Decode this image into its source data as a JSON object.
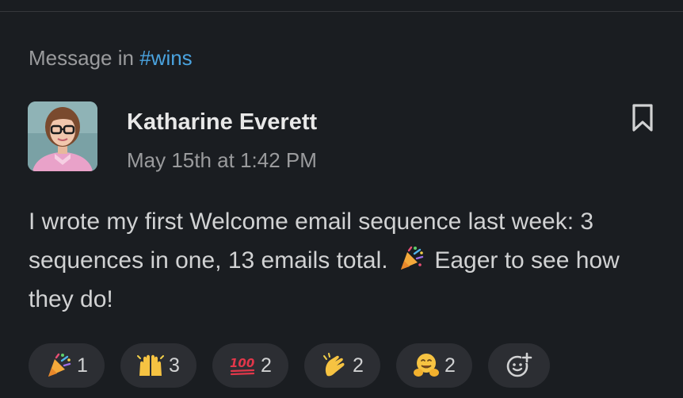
{
  "context": {
    "prefix": "Message in",
    "channel": "#wins"
  },
  "message": {
    "author": "Katharine Everett",
    "timestamp": "May 15th at 1:42 PM",
    "text_before_emoji": "I wrote my first Welcome email sequence last week: 3 sequences in one, 13 emails total.",
    "inline_emoji": "tada-icon",
    "text_after_emoji": "Eager to see how they do!"
  },
  "reactions": [
    {
      "emoji": "tada-icon",
      "count": "1"
    },
    {
      "emoji": "raised-hands-icon",
      "count": "3"
    },
    {
      "emoji": "hundred-points-icon",
      "count": "2"
    },
    {
      "emoji": "clapping-hands-icon",
      "count": "2"
    },
    {
      "emoji": "hugging-face-icon",
      "count": "2"
    }
  ],
  "add_reaction_icon": "add-emoji-reaction-icon",
  "bookmark_icon": "bookmark-icon",
  "colors": {
    "background": "#1a1d21",
    "channel_link": "#4aa3df",
    "reaction_pill": "#2c2e33"
  }
}
